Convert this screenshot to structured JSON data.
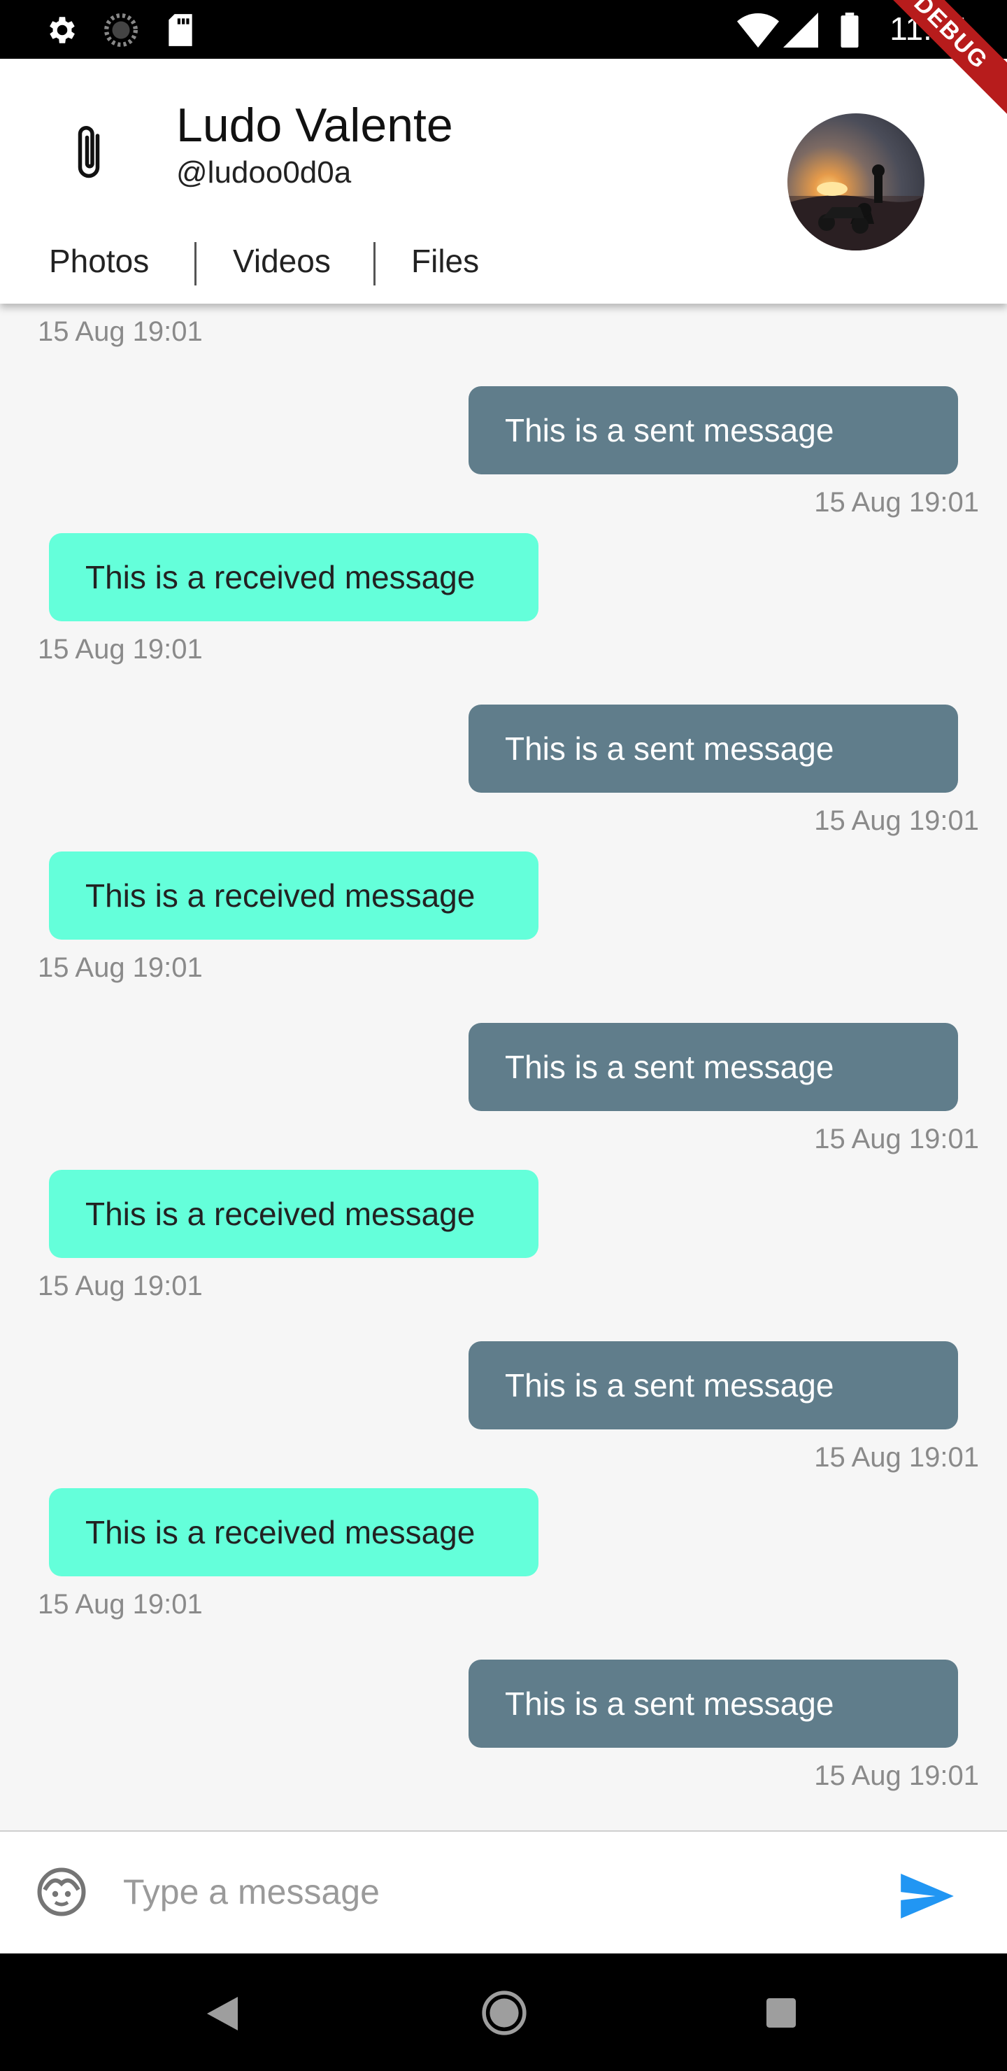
{
  "status_bar": {
    "time": "11:34",
    "icons": [
      "settings-icon",
      "sync-icon",
      "sd-card-icon",
      "wifi-icon",
      "signal-icon",
      "battery-icon"
    ]
  },
  "debug_banner": "DEBUG",
  "header": {
    "name": "Ludo Valente",
    "handle": "@ludoo0d0a",
    "tabs": [
      {
        "label": "Photos"
      },
      {
        "label": "Videos"
      },
      {
        "label": "Files"
      }
    ]
  },
  "messages": {
    "top_timestamp": "15 Aug 19:01",
    "items": [
      {
        "type": "sent",
        "text": "This is a sent message",
        "time": "15 Aug 19:01"
      },
      {
        "type": "received",
        "text": "This is a received message",
        "time": "15 Aug 19:01"
      },
      {
        "type": "sent",
        "text": "This is a sent message",
        "time": "15 Aug 19:01"
      },
      {
        "type": "received",
        "text": "This is a received message",
        "time": "15 Aug 19:01"
      },
      {
        "type": "sent",
        "text": "This is a sent message",
        "time": "15 Aug 19:01"
      },
      {
        "type": "received",
        "text": "This is a received message",
        "time": "15 Aug 19:01"
      },
      {
        "type": "sent",
        "text": "This is a sent message",
        "time": "15 Aug 19:01"
      },
      {
        "type": "received",
        "text": "This is a received message",
        "time": "15 Aug 19:01"
      },
      {
        "type": "sent",
        "text": "This is a sent message",
        "time": "15 Aug 19:01"
      }
    ]
  },
  "composer": {
    "placeholder": "Type a message",
    "value": ""
  },
  "colors": {
    "sent_bubble": "#607d8b",
    "received_bubble": "#64ffda",
    "send_accent": "#2196f3"
  }
}
